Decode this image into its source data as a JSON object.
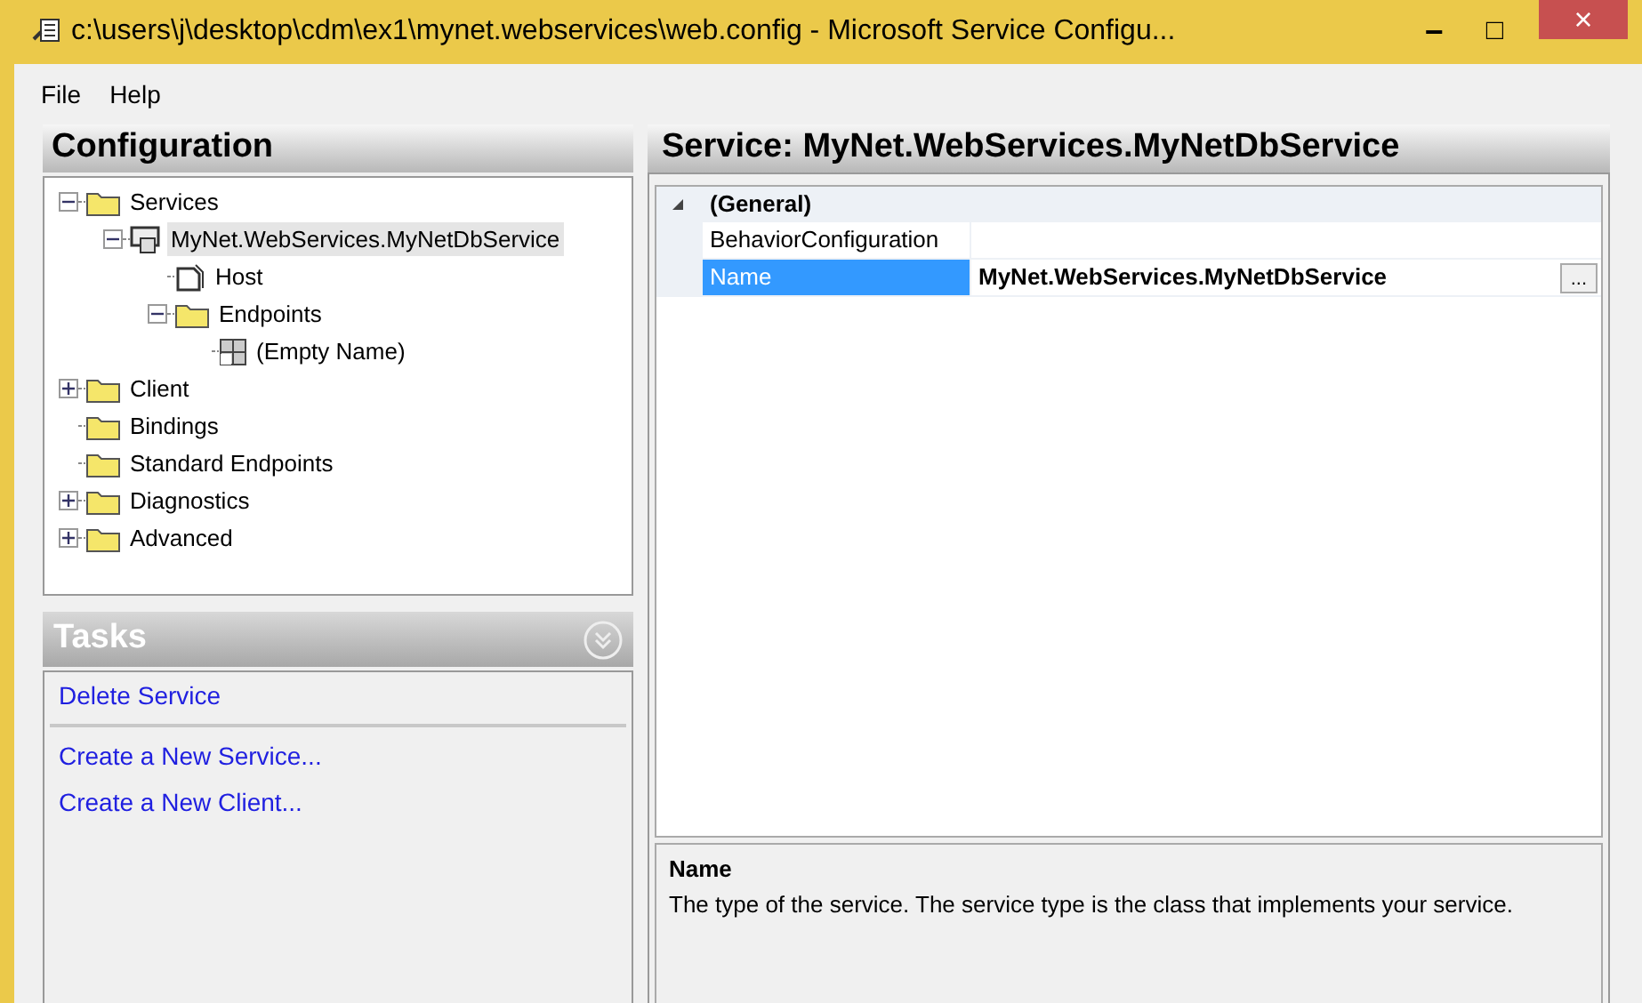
{
  "window": {
    "title": "c:\\users\\j\\desktop\\cdm\\ex1\\mynet.webservices\\web.config - Microsoft Service Configu...",
    "controls": [
      {
        "kind": "minimize",
        "label": "−"
      },
      {
        "kind": "maximize",
        "label": "□"
      },
      {
        "kind": "close",
        "label": "×"
      }
    ]
  },
  "menu": [
    "File",
    "Help"
  ],
  "configuration": {
    "title": "Configuration",
    "tree": [
      {
        "label": "Services",
        "kind": "folder",
        "expanded": true,
        "selected": false,
        "children": [
          {
            "label": "MyNet.WebServices.MyNetDbService",
            "kind": "service",
            "expanded": true,
            "selected": true,
            "children": [
              {
                "label": "Host",
                "kind": "host",
                "selected": false
              },
              {
                "label": "Endpoints",
                "kind": "folder",
                "expanded": true,
                "selected": false,
                "children": [
                  {
                    "label": "(Empty Name)",
                    "kind": "endpoint",
                    "selected": false
                  }
                ]
              }
            ]
          }
        ]
      },
      {
        "label": "Client",
        "kind": "folder",
        "expanded": false,
        "selected": false
      },
      {
        "label": "Bindings",
        "kind": "folder",
        "selected": false
      },
      {
        "label": "Standard Endpoints",
        "kind": "folder",
        "selected": false
      },
      {
        "label": "Diagnostics",
        "kind": "folder",
        "expanded": false,
        "selected": false
      },
      {
        "label": "Advanced",
        "kind": "folder",
        "expanded": false,
        "selected": false
      }
    ]
  },
  "tasks": {
    "title": "Tasks",
    "groups": [
      [
        "Delete Service"
      ],
      [
        "Create a New Service...",
        "Create a New Client..."
      ]
    ]
  },
  "service": {
    "title": "Service: MyNet.WebServices.MyNetDbService",
    "category": {
      "label": "(General)",
      "expanded": true
    },
    "properties": [
      {
        "name": "BehaviorConfiguration",
        "selected": false
      },
      {
        "name": "Name",
        "value": "MyNet.WebServices.MyNetDbService",
        "modified": true,
        "selected": true,
        "button": "..."
      }
    ],
    "description": {
      "title": "Name",
      "text": "The type of the service. The service type is the class that implements your service."
    }
  }
}
